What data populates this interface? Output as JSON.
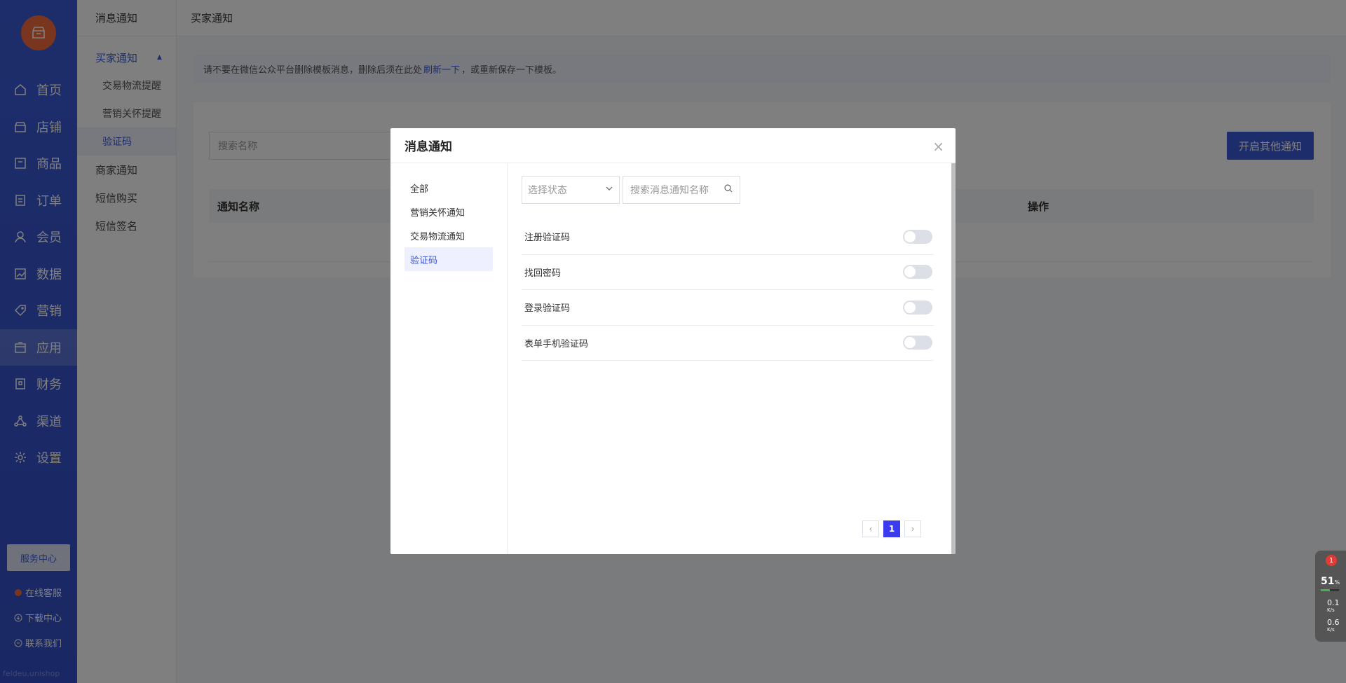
{
  "sidebar": {
    "logo_icon": "shop-icon",
    "items": [
      {
        "label": "首页",
        "icon": "home-icon"
      },
      {
        "label": "店铺",
        "icon": "store-icon"
      },
      {
        "label": "商品",
        "icon": "goods-icon"
      },
      {
        "label": "订单",
        "icon": "order-icon"
      },
      {
        "label": "会员",
        "icon": "user-icon"
      },
      {
        "label": "数据",
        "icon": "chart-icon"
      },
      {
        "label": "营销",
        "icon": "tag-icon"
      },
      {
        "label": "应用",
        "icon": "app-icon"
      },
      {
        "label": "财务",
        "icon": "finance-icon"
      },
      {
        "label": "渠道",
        "icon": "channel-icon"
      },
      {
        "label": "设置",
        "icon": "gear-icon"
      }
    ],
    "active_item": "应用",
    "service_center": "服务中心",
    "online_support": "在线客服",
    "download_center": "下载中心",
    "contact_us": "联系我们",
    "watermark": "feldeu.unishop"
  },
  "subsidebar": {
    "title": "消息通知",
    "group": "买家通知",
    "group_items": [
      "交易物流提醒",
      "营销关怀提醒",
      "验证码"
    ],
    "active_group_item": "验证码",
    "plain_items": [
      "商家通知",
      "短信购买",
      "短信签名"
    ]
  },
  "main": {
    "breadcrumb": "买家通知",
    "notice": {
      "before": "请不要在微信公众平台删除模板消息，删除后须在此处",
      "link": "刷新一下",
      "after": "，或重新保存一下模板。"
    },
    "search_placeholder": "搜索名称",
    "open_button": "开启其他通知",
    "table_headers": {
      "name": "通知名称",
      "action": "操作"
    }
  },
  "modal": {
    "title": "消息通知",
    "categories": [
      "全部",
      "营销关怀通知",
      "交易物流通知",
      "验证码"
    ],
    "active_category": "验证码",
    "status_placeholder": "选择状态",
    "search_placeholder": "搜索消息通知名称",
    "rows": [
      {
        "name": "注册验证码",
        "enabled": false
      },
      {
        "name": "找回密码",
        "enabled": false
      },
      {
        "name": "登录验证码",
        "enabled": false
      },
      {
        "name": "表单手机验证码",
        "enabled": false
      }
    ],
    "pagination": {
      "current": "1"
    }
  },
  "widget": {
    "badge": "1",
    "cpu_percent": "51",
    "cpu_unit": "%",
    "upload": "0.1",
    "download": "0.6",
    "speed_unit": "K/s"
  }
}
